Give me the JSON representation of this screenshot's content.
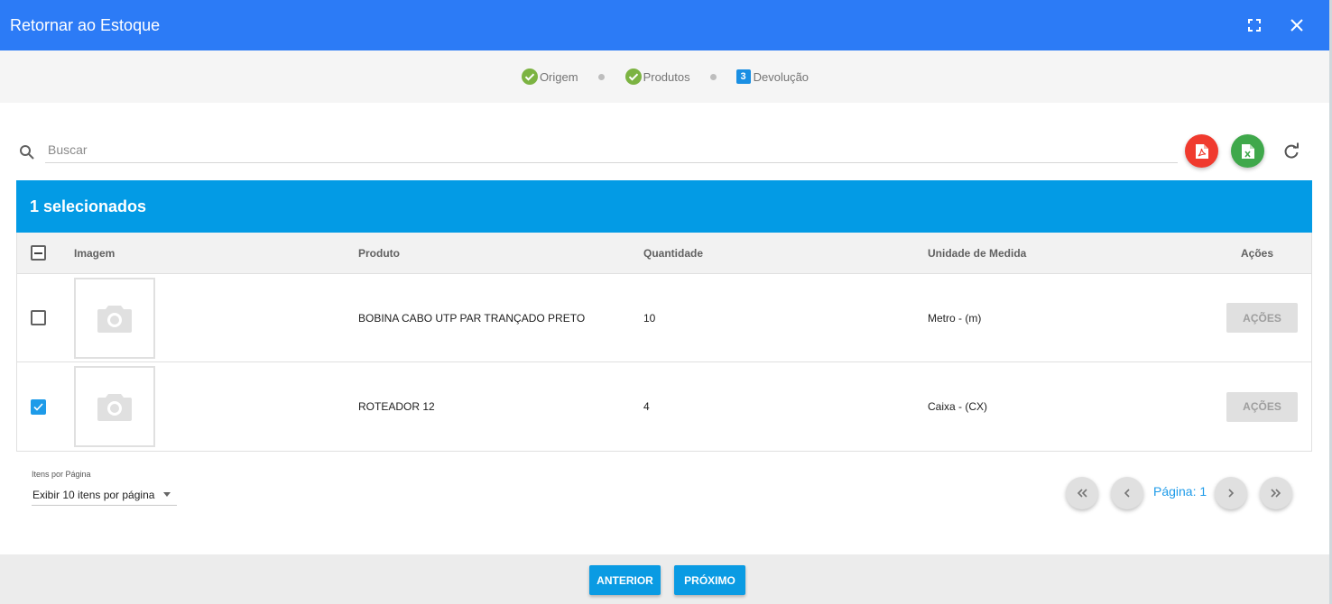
{
  "dialog": {
    "title": "Retornar ao Estoque"
  },
  "stepper": {
    "steps": [
      {
        "label": "Origem",
        "state": "done"
      },
      {
        "label": "Produtos",
        "state": "done"
      },
      {
        "label": "Devolução",
        "state": "active",
        "number": "3"
      }
    ]
  },
  "search": {
    "placeholder": "Buscar",
    "value": ""
  },
  "selection": {
    "text": "1 selecionados"
  },
  "table": {
    "headers": {
      "image": "Imagem",
      "product": "Produto",
      "quantity": "Quantidade",
      "unit": "Unidade de Medida",
      "actions": "Ações"
    },
    "rows": [
      {
        "product": "BOBINA CABO UTP PAR TRANÇADO PRETO",
        "quantity": "10",
        "unit": "Metro - (m)",
        "action": "AÇÕES",
        "checked": false
      },
      {
        "product": "ROTEADOR 12",
        "quantity": "4",
        "unit": "Caixa - (CX)",
        "action": "AÇÕES",
        "checked": true
      }
    ]
  },
  "pagination": {
    "items_per_page_label": "Itens por Página",
    "items_per_page_value": "Exibir 10 itens por página",
    "page_label": "Página: 1"
  },
  "footer": {
    "previous": "ANTERIOR",
    "next": "PRÓXIMO"
  },
  "colors": {
    "header": "#2c7bf6",
    "selection_bar": "#039be5",
    "pdf": "#f03a2e",
    "excel": "#3fa84b",
    "done_step": "#7cb342",
    "primary_button": "#0a9be3"
  }
}
